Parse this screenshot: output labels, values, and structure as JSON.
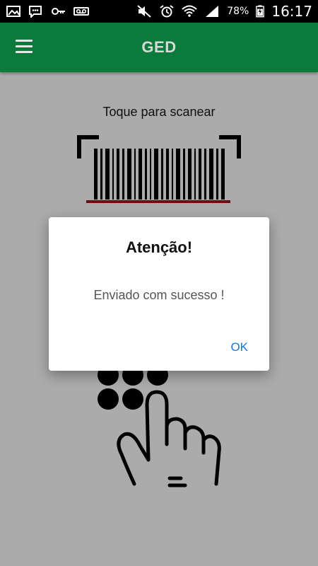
{
  "status_bar": {
    "left_icons": [
      "gallery-icon",
      "chat-icon",
      "key-icon",
      "voicemail-icon"
    ],
    "right_icons": [
      "mute-icon",
      "alarm-icon",
      "wifi-icon",
      "signal-icon",
      "battery-icon"
    ],
    "battery_percent": "78%",
    "time": "16:17"
  },
  "app_bar": {
    "title": "GED",
    "color": "#0b7a3a",
    "menu_icon": "hamburger-menu-icon"
  },
  "main": {
    "scan_label": "Toque para scanear",
    "illustration": "barcode-tap-illustration"
  },
  "dialog": {
    "title": "Atenção!",
    "message": "Enviado com sucesso !",
    "ok_label": "OK",
    "ok_color": "#1a73d9"
  }
}
